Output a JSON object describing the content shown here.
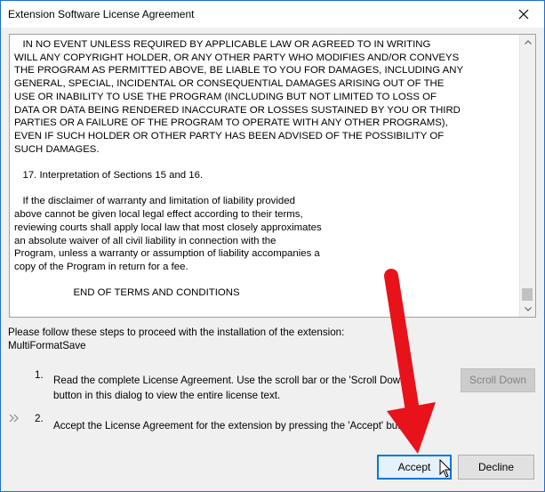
{
  "window": {
    "title": "Extension Software License Agreement"
  },
  "license": {
    "text": "   IN NO EVENT UNLESS REQUIRED BY APPLICABLE LAW OR AGREED TO IN WRITING\nWILL ANY COPYRIGHT HOLDER, OR ANY OTHER PARTY WHO MODIFIES AND/OR CONVEYS\nTHE PROGRAM AS PERMITTED ABOVE, BE LIABLE TO YOU FOR DAMAGES, INCLUDING ANY\nGENERAL, SPECIAL, INCIDENTAL OR CONSEQUENTIAL DAMAGES ARISING OUT OF THE\nUSE OR INABILITY TO USE THE PROGRAM (INCLUDING BUT NOT LIMITED TO LOSS OF\nDATA OR DATA BEING RENDERED INACCURATE OR LOSSES SUSTAINED BY YOU OR THIRD\nPARTIES OR A FAILURE OF THE PROGRAM TO OPERATE WITH ANY OTHER PROGRAMS),\nEVEN IF SUCH HOLDER OR OTHER PARTY HAS BEEN ADVISED OF THE POSSIBILITY OF\nSUCH DAMAGES.\n\n   17. Interpretation of Sections 15 and 16.\n\n   If the disclaimer of warranty and limitation of liability provided\nabove cannot be given local legal effect according to their terms,\nreviewing courts shall apply local law that most closely approximates\nan absolute waiver of all civil liability in connection with the\nProgram, unless a warranty or assumption of liability accompanies a\ncopy of the Program in return for a fee.\n\n                     END OF TERMS AND CONDITIONS"
  },
  "instructions": {
    "line1": "Please follow these steps to proceed with the installation of the extension:",
    "line2": "MultiFormatSave"
  },
  "steps": [
    {
      "number": "1.",
      "text_line1": "Read the complete License Agreement. Use the scroll bar or the 'Scroll Down'",
      "text_line2": "button in this dialog to view the entire license text."
    },
    {
      "number": "2.",
      "text_line1": "Accept the License Agreement for the extension by pressing the 'Accept' button."
    }
  ],
  "buttons": {
    "scroll_down": "Scroll Down",
    "accept": "Accept",
    "decline": "Decline"
  },
  "colors": {
    "annotation_arrow": "#e8121b",
    "focus_border": "#0078d7"
  }
}
